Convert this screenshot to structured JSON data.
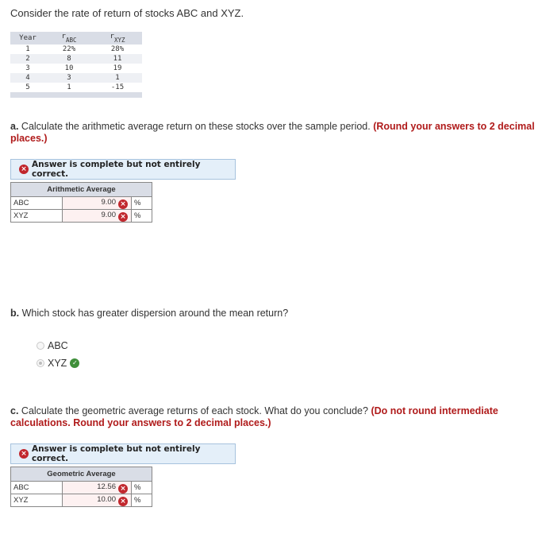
{
  "intro": "Consider the rate of return of stocks ABC and XYZ.",
  "returns_table": {
    "headers": [
      {
        "main": "Year",
        "sub": ""
      },
      {
        "main": "r",
        "sub": "ABC"
      },
      {
        "main": "r",
        "sub": "XYZ"
      }
    ],
    "rows": [
      {
        "year": "1",
        "abc": "22%",
        "xyz": "28%"
      },
      {
        "year": "2",
        "abc": "8",
        "xyz": "11"
      },
      {
        "year": "3",
        "abc": "10",
        "xyz": "19"
      },
      {
        "year": "4",
        "abc": "3",
        "xyz": "1"
      },
      {
        "year": "5",
        "abc": "1",
        "xyz": "-15"
      }
    ]
  },
  "part_a": {
    "label": "a.",
    "question": " Calculate the arithmetic average return on these stocks over the sample period. ",
    "hint": "(Round your answers to 2 decimal places.)",
    "banner": "Answer is complete but not entirely correct.",
    "table_header": "Arithmetic Average",
    "rows": [
      {
        "label": "ABC",
        "value": "9.00",
        "unit": "%",
        "status": "incorrect"
      },
      {
        "label": "XYZ",
        "value": "9.00",
        "unit": "%",
        "status": "incorrect"
      }
    ]
  },
  "part_b": {
    "label": "b.",
    "question": " Which stock has greater dispersion around the mean return?",
    "options": [
      {
        "label": "ABC",
        "selected": false
      },
      {
        "label": "XYZ",
        "selected": true,
        "status": "correct"
      }
    ]
  },
  "part_c": {
    "label": "c.",
    "question": " Calculate the geometric average returns of each stock. What do you conclude? ",
    "hint": "(Do not round intermediate calculations. Round your answers to 2 decimal places.)",
    "banner": "Answer is complete but not entirely correct.",
    "table_header": "Geometric Average",
    "rows": [
      {
        "label": "ABC",
        "value": "12.56",
        "unit": "%",
        "status": "incorrect"
      },
      {
        "label": "XYZ",
        "value": "10.00",
        "unit": "%",
        "status": "incorrect"
      }
    ]
  },
  "icons": {
    "incorrect": "×",
    "correct": "✓"
  },
  "colors": {
    "incorrect": "#c1272d",
    "correct": "#3f8f3a",
    "hint": "#b01b1b",
    "banner_bg": "#e4eff9"
  }
}
